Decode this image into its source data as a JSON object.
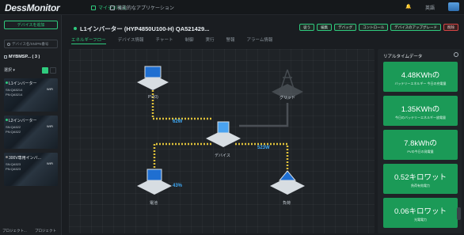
{
  "app": {
    "logo": "DessMonitor",
    "logo_accent": "D"
  },
  "topnav": {
    "my_devices": "マイデバイス",
    "features": "機能的なアプリケーション",
    "lang": "英語"
  },
  "sidebar": {
    "add_device": "デバイスを追加",
    "search_placeholder": "デバイス名/SN/PN番号",
    "group": "MYBMSP... ( 3 )",
    "select": "選択",
    "devices": [
      {
        "name": "L1インバーター",
        "sn1": "SN:QA5214",
        "sn2": "PN:QA5214",
        "wifi": "WiFi",
        "online": true
      },
      {
        "name": "L2インバーター",
        "sn1": "SN:QA522",
        "sn2": "PN:QA522",
        "wifi": "WiFi",
        "online": true
      },
      {
        "name": "300V専用インバ...",
        "sn1": "SN:QA523",
        "sn2": "PN:QA523",
        "wifi": "WiFi",
        "online": false
      }
    ],
    "footer_left": "プロジェクト...",
    "footer_right": "プロジェクト"
  },
  "header": {
    "title": "L1インバーター (HYP4850U100-H) QA521429...",
    "buttons": [
      "従う",
      "編集",
      "デバッグ",
      "コントロール",
      "デバイスのアップグレード",
      "削除"
    ]
  },
  "tabs": [
    "エネルギーフロー",
    "デバイス情報",
    "チャート",
    "制御",
    "実行",
    "警報",
    "アラーム情報"
  ],
  "flow": {
    "pv_label": "PV(0)",
    "grid_label": "グリッド",
    "device_label": "デバイス",
    "battery_label": "電池",
    "load_label": "負荷",
    "pv_power": "62W",
    "load_power": "523W",
    "battery_pct": "43%",
    "colors": {
      "line": "#e0c23a",
      "text": "#3fa9f5"
    }
  },
  "realtime": {
    "title": "リアルタイムデータ",
    "stats": [
      {
        "value": "4.48KWhの",
        "label": "バッテリーエネルギー 今日の充電量"
      },
      {
        "value": "1.35KWhの",
        "label": "今日のバッテリーエネルギー放電量"
      },
      {
        "value": "7.8kWhの",
        "label": "PVの今日の発電量"
      },
      {
        "value": "0.52キロワット",
        "label": "負荷有効電力"
      },
      {
        "value": "0.06キロワット",
        "label": "光電電力"
      }
    ]
  }
}
